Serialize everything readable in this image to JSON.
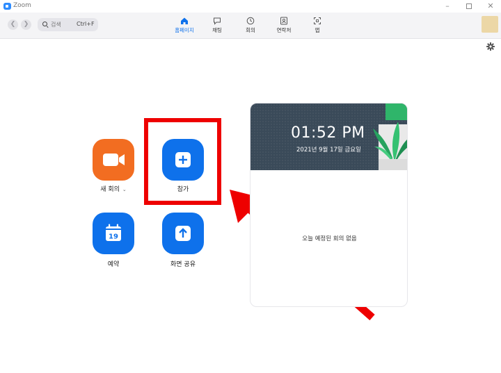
{
  "window": {
    "title": "Zoom"
  },
  "search": {
    "label": "검색",
    "shortcut": "Ctrl+F"
  },
  "tabs": [
    {
      "label": "홈페이지",
      "icon": "home-icon",
      "active": true
    },
    {
      "label": "채팅",
      "icon": "chat-icon",
      "active": false
    },
    {
      "label": "회의",
      "icon": "clock-icon",
      "active": false
    },
    {
      "label": "연락처",
      "icon": "contacts-icon",
      "active": false
    },
    {
      "label": "앱",
      "icon": "apps-icon",
      "active": false
    }
  ],
  "actions": {
    "new_meeting": {
      "label": "새 회의",
      "icon": "video-camera-icon"
    },
    "join": {
      "label": "참가",
      "icon": "plus-icon"
    },
    "schedule": {
      "label": "예약",
      "icon": "calendar-icon",
      "calendar_day": "19"
    },
    "share_screen": {
      "label": "화면 공유",
      "icon": "upload-arrow-icon"
    }
  },
  "calendar_card": {
    "time": "01:52 PM",
    "date": "2021년 9월 17일 금요일",
    "empty_message": "오늘 예정된 회의 없음"
  },
  "colors": {
    "accent_blue": "#0e71eb",
    "orange": "#f26d21",
    "highlight_red": "#ee0000",
    "card_header": "#3a4a59"
  }
}
